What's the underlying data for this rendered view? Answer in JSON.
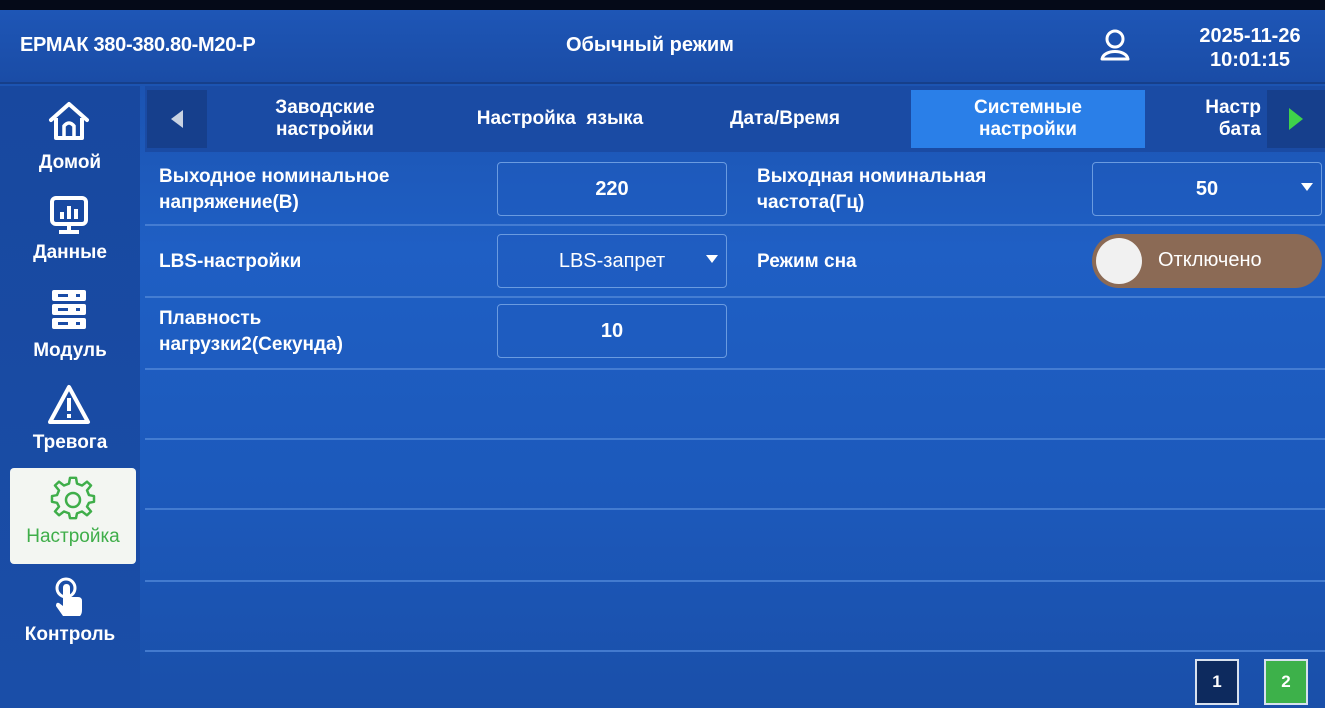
{
  "header": {
    "device_name": "ЕРМАК 380-380.80-M20-P",
    "mode": "Обычный режим",
    "date": "2025-11-26",
    "time": "10:01:15"
  },
  "sidebar": {
    "items": [
      {
        "label": "Домой",
        "icon": "home-icon"
      },
      {
        "label": "Данные",
        "icon": "monitor-chart-icon"
      },
      {
        "label": "Модуль",
        "icon": "server-rack-icon"
      },
      {
        "label": "Тревога",
        "icon": "warning-triangle-icon"
      },
      {
        "label": "Настройка",
        "icon": "gear-icon",
        "active": true
      },
      {
        "label": "Контроль",
        "icon": "touch-hand-icon"
      }
    ]
  },
  "tabs": [
    {
      "line1": "Заводские",
      "line2": "настройки"
    },
    {
      "line1": "Настройка  языка",
      "line2": ""
    },
    {
      "line1": "Дата/Время",
      "line2": ""
    },
    {
      "line1": "Системные",
      "line2": "настройки",
      "active": true
    },
    {
      "line1": "Настр",
      "line2": "бата"
    }
  ],
  "settings": {
    "output_voltage": {
      "label_1": "Выходное номинальное",
      "label_2": "напряжение(В)",
      "value": "220"
    },
    "output_frequency": {
      "label_1": "Выходная номинальная",
      "label_2": "частота(Гц)",
      "value": "50"
    },
    "lbs": {
      "label": "LBS-настройки",
      "value": "LBS-запрет"
    },
    "sleep_mode": {
      "label": "Режим сна",
      "value": "Отключено",
      "on": false
    },
    "load_smoothness": {
      "label_1": "Плавность",
      "label_2": "нагрузки2(Секунда)",
      "value": "10"
    }
  },
  "pager": {
    "page1": "1",
    "page2": "2",
    "current": "2"
  },
  "colors": {
    "background": "#1c59bb",
    "active_tab": "#2a7fe8",
    "active_nav_text": "#3fae4a",
    "toggle_off": "#8b6a55",
    "page_active": "#3db14a"
  }
}
